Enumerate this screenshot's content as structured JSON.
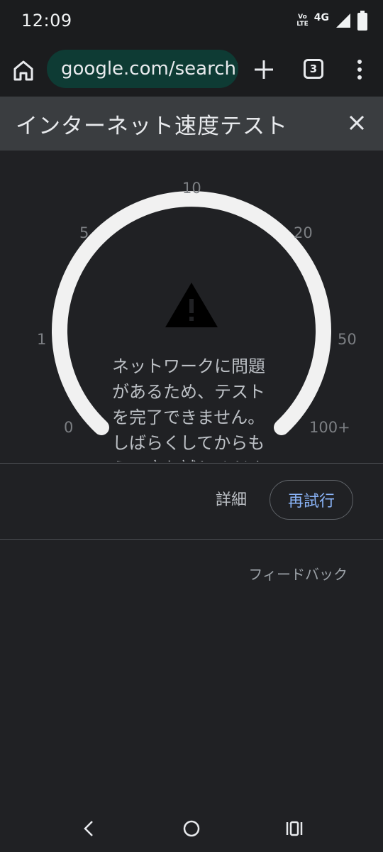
{
  "status_bar": {
    "time": "12:09",
    "volte_top": "Vo",
    "volte_bottom": "LTE",
    "network": "4G",
    "icons": [
      "wifi-calling-icon",
      "signal-icon",
      "battery-icon"
    ]
  },
  "toolbar": {
    "url": "google.com/search?q=speed+test",
    "tab_count": "3",
    "icons": [
      "home-icon",
      "site-settings-icon",
      "plus-icon",
      "tabs-icon",
      "more-vert-icon"
    ]
  },
  "panel": {
    "title": "インターネット速度テスト",
    "close_icon": "close-icon"
  },
  "gauge": {
    "ticks": [
      "0",
      "1",
      "5",
      "10",
      "20",
      "50",
      "100+"
    ],
    "arc_color": "#f1f1f1",
    "warning_icon": "warning-icon",
    "error_message": "ネットワークに問題があるため、テストを完了できません。しばらくしてからもう一度お試しください。"
  },
  "actions": {
    "details_label": "詳細",
    "retry_label": "再試行",
    "feedback_label": "フィードバック"
  },
  "nav_bar": {
    "icons": [
      "back-icon",
      "home-circle-icon",
      "recents-icon"
    ]
  },
  "colors": {
    "background": "#202124",
    "header_bg": "#3a3d40",
    "url_bar_bg": "#0e3b34",
    "accent": "#8ab4f8"
  }
}
